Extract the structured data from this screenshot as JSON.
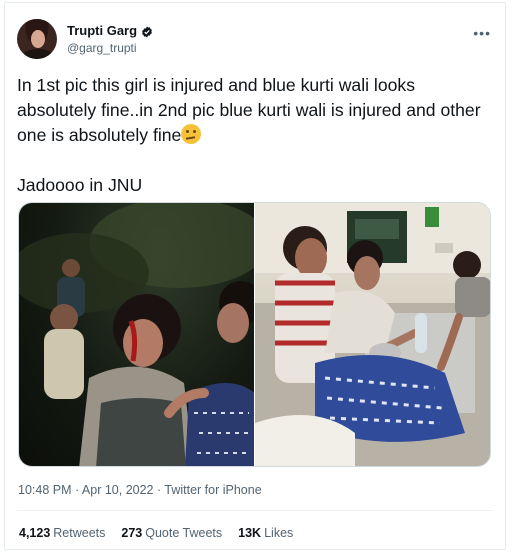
{
  "author": {
    "display_name": "Trupti Garg",
    "handle": "@garg_trupti",
    "verified_color": "#0f1419"
  },
  "tweet": {
    "text_line1": "In 1st pic this girl is injured and blue kurti wali looks absolutely fine..in 2nd pic blue kurti wali is injured and other one is absolutely fine",
    "emoji": "thinking-face",
    "text_line2": "Jadoooo in JNU",
    "timestamp": "10:48 PM · Apr 10, 2022 · Twitter for iPhone"
  },
  "stats": {
    "retweets_count": "4,123",
    "retweets_label": "Retweets",
    "quotes_count": "273",
    "quotes_label": "Quote Tweets",
    "likes_count": "13K",
    "likes_label": "Likes"
  },
  "colors": {
    "text": "#0f1419",
    "secondary": "#536471",
    "border": "#cfd9de"
  }
}
